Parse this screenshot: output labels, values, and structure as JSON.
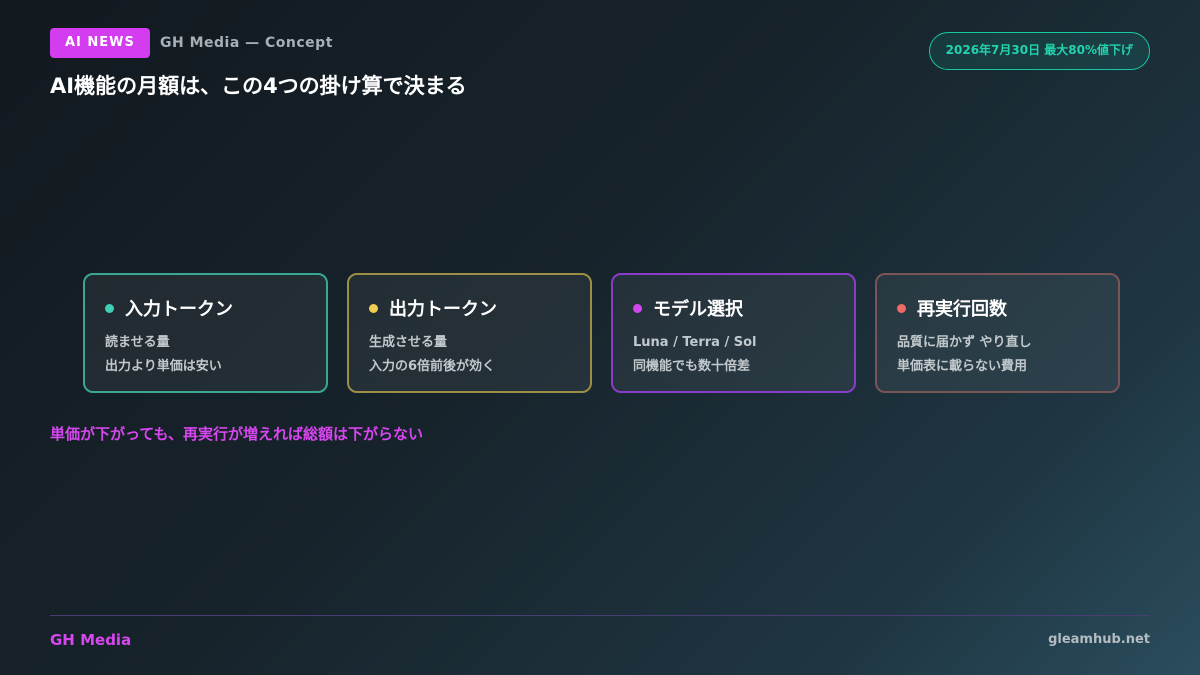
{
  "header": {
    "badge": "AI NEWS",
    "brand_concept": "GH Media — Concept",
    "title": "AI機能の月額は、この4つの掛け算で決まる",
    "date_pill": "2026年7月30日 最大80%値下げ"
  },
  "cards": [
    {
      "title": "入力トークン",
      "lines": [
        "読ませる量",
        "出力より単価は安い"
      ],
      "accent": "#3fd1b7"
    },
    {
      "title": "出力トークン",
      "lines": [
        "生成させる量",
        "入力の6倍前後が効く"
      ],
      "accent": "#f1cc53"
    },
    {
      "title": "モデル選択",
      "lines": [
        "Luna / Terra / Sol",
        "同機能でも数十倍差"
      ],
      "accent": "#d047f0"
    },
    {
      "title": "再実行回数",
      "lines": [
        "品質に届かず やり直し",
        "単価表に載らない費用"
      ],
      "accent": "#f06a64"
    }
  ],
  "note": "単価が下がっても、再実行が増えれば総額は下がらない",
  "footer": {
    "brand": "GH Media",
    "url": "gleamhub.net"
  },
  "colors": {
    "accent_pink": "#d846f0",
    "accent_teal": "#22d3ae"
  }
}
